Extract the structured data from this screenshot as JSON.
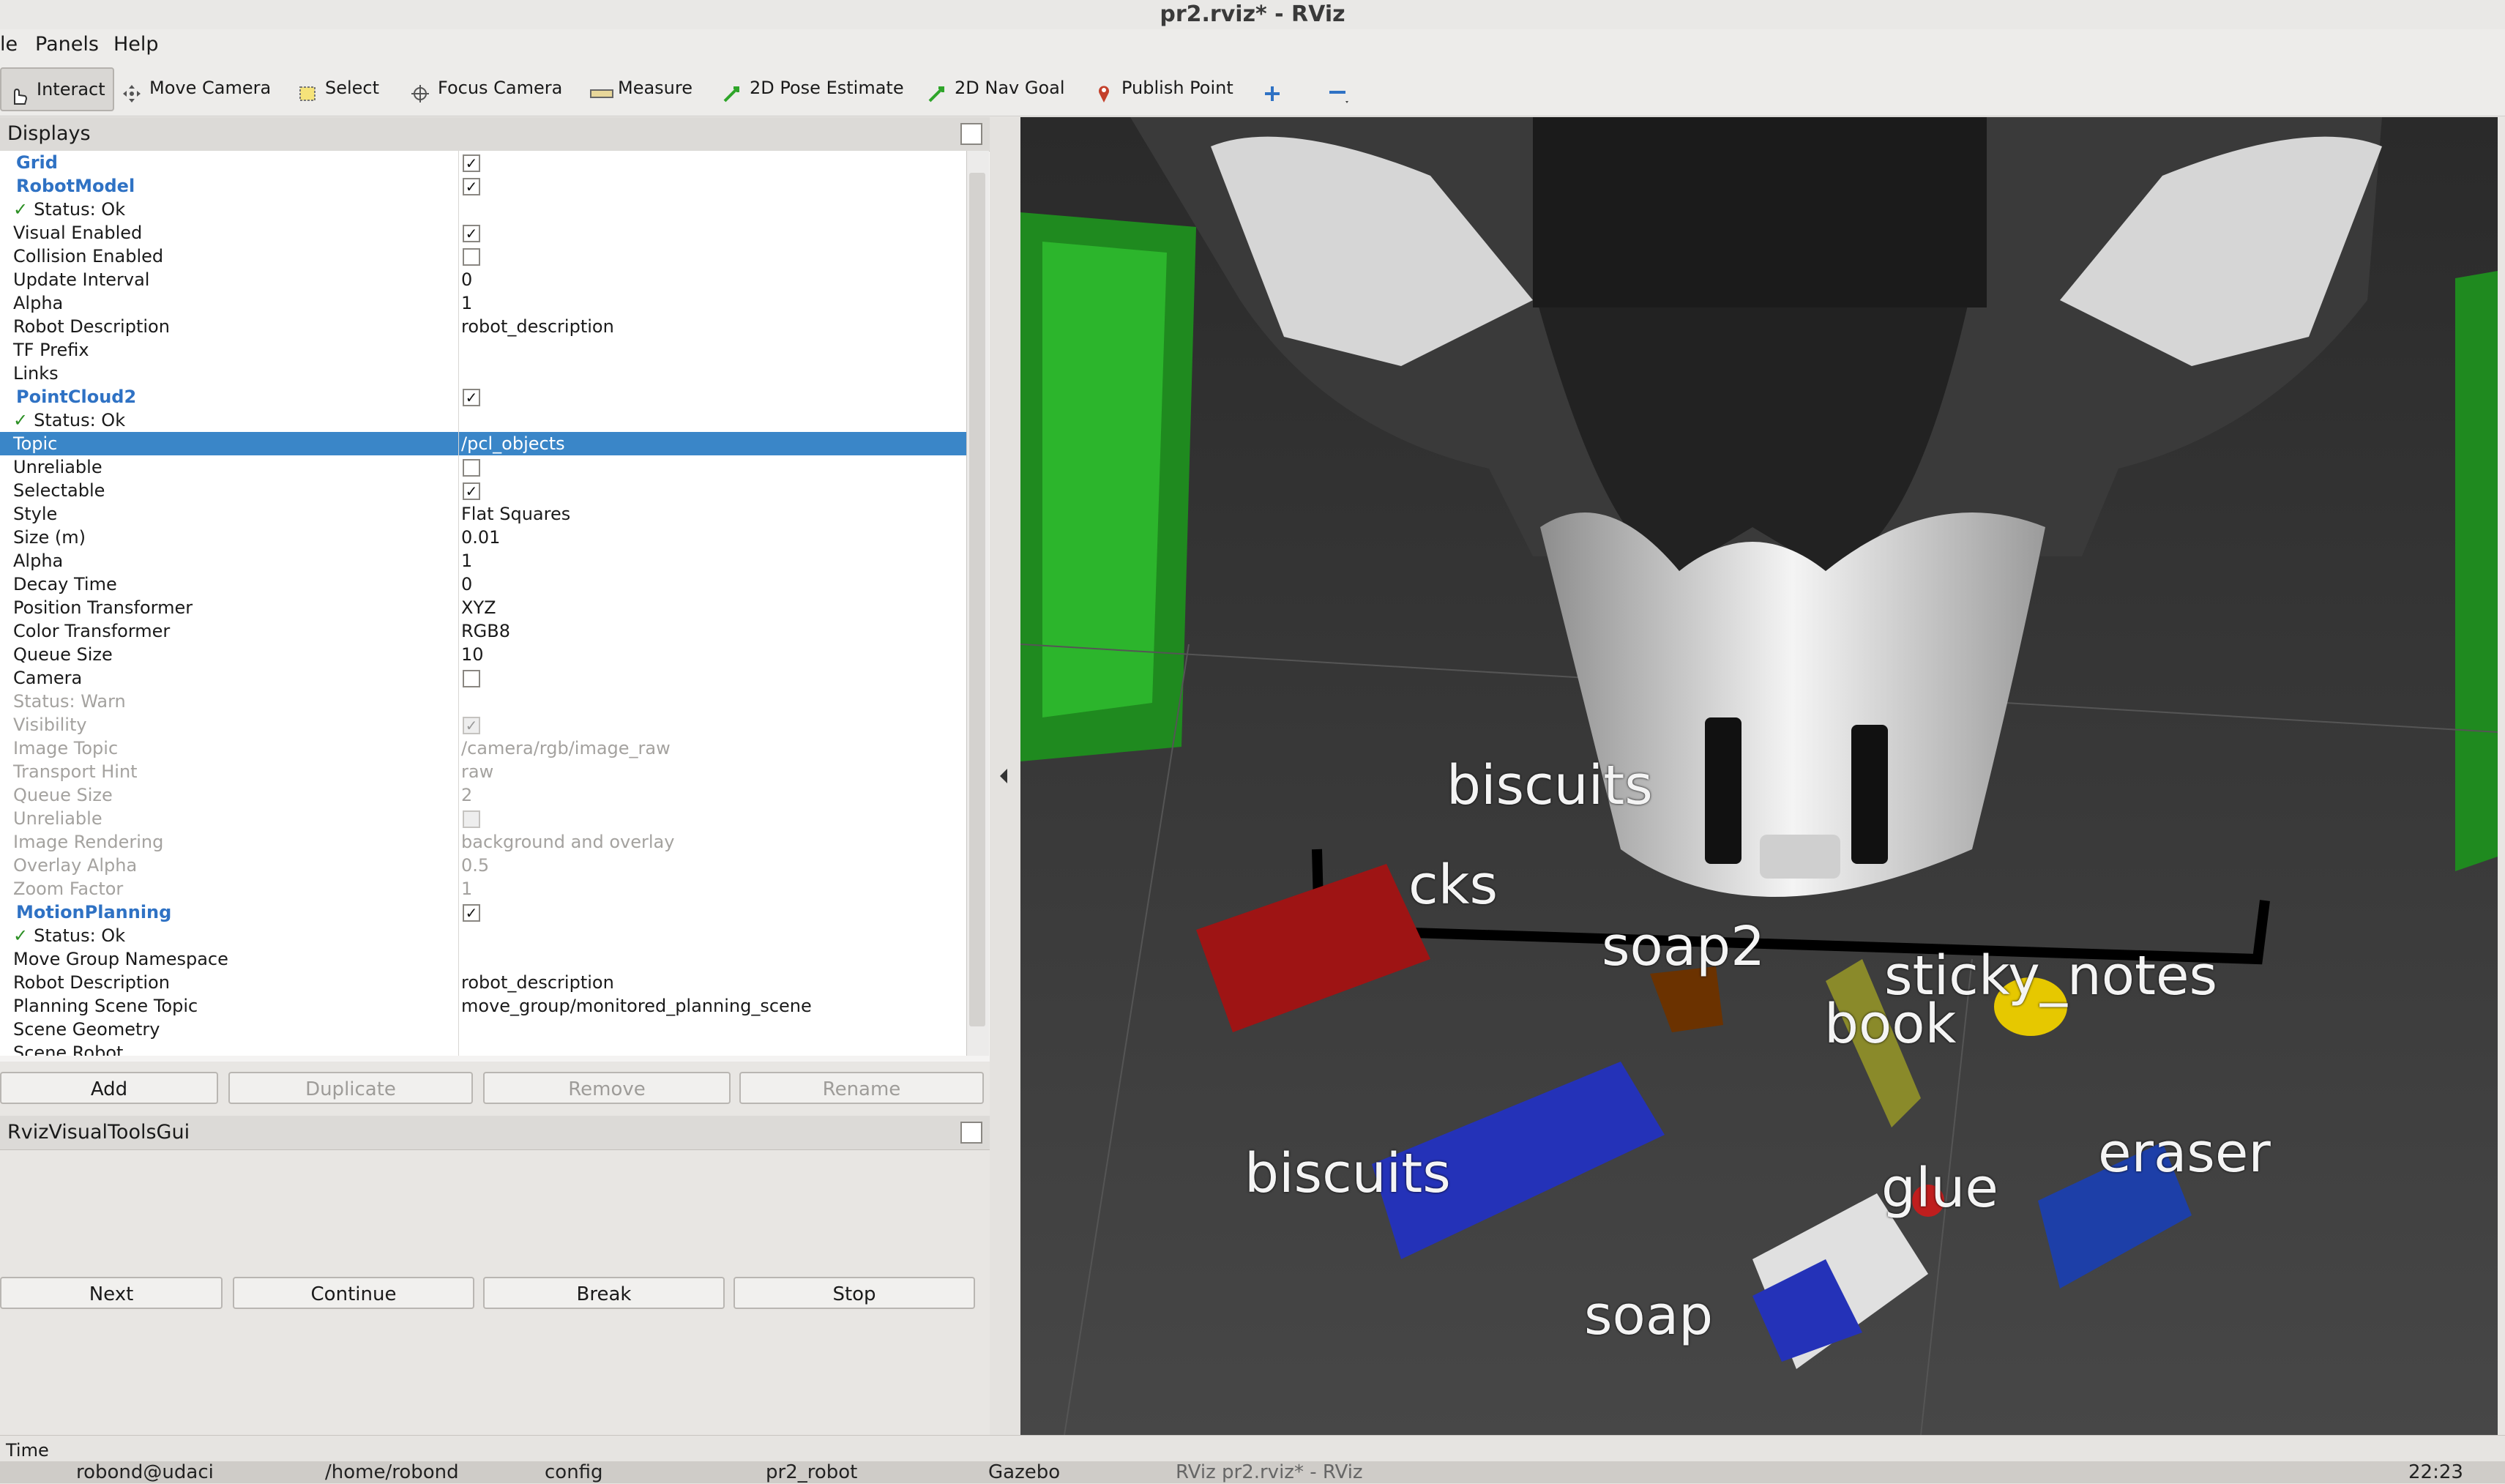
{
  "window": {
    "title": "pr2.rviz* - RViz"
  },
  "menubar": {
    "items": [
      "le",
      "Panels",
      "Help"
    ]
  },
  "toolbar": {
    "tools": [
      {
        "label": "Interact",
        "icon": "hand-pointer-icon",
        "active": true
      },
      {
        "label": "Move Camera",
        "icon": "move-camera-icon"
      },
      {
        "label": "Select",
        "icon": "select-box-icon"
      },
      {
        "label": "Focus Camera",
        "icon": "focus-camera-icon"
      },
      {
        "label": "Measure",
        "icon": "ruler-icon"
      },
      {
        "label": "2D Pose Estimate",
        "icon": "green-arrow-icon"
      },
      {
        "label": "2D Nav Goal",
        "icon": "green-arrow-icon"
      },
      {
        "label": "Publish Point",
        "icon": "map-pin-icon"
      }
    ]
  },
  "displays": {
    "title": "Displays",
    "rows": [
      {
        "name": "Grid",
        "type": "group",
        "checked": true
      },
      {
        "name": "RobotModel",
        "type": "group",
        "checked": true
      },
      {
        "name": "Status: Ok",
        "type": "status"
      },
      {
        "name": "Visual Enabled",
        "checked": true
      },
      {
        "name": "Collision Enabled",
        "checked": false
      },
      {
        "name": "Update Interval",
        "value": "0"
      },
      {
        "name": "Alpha",
        "value": "1"
      },
      {
        "name": "Robot Description",
        "value": "robot_description"
      },
      {
        "name": "TF Prefix",
        "value": ""
      },
      {
        "name": "Links",
        "value": ""
      },
      {
        "name": "PointCloud2",
        "type": "group",
        "checked": true
      },
      {
        "name": "Status: Ok",
        "type": "status"
      },
      {
        "name": "Topic",
        "value": "/pcl_objects",
        "selected": true
      },
      {
        "name": "Unreliable",
        "checked": false
      },
      {
        "name": "Selectable",
        "checked": true
      },
      {
        "name": "Style",
        "value": "Flat Squares"
      },
      {
        "name": "Size (m)",
        "value": "0.01"
      },
      {
        "name": "Alpha",
        "value": "1"
      },
      {
        "name": "Decay Time",
        "value": "0"
      },
      {
        "name": "Position Transformer",
        "value": "XYZ"
      },
      {
        "name": "Color Transformer",
        "value": "RGB8"
      },
      {
        "name": "Queue Size",
        "value": "10"
      },
      {
        "name": "Camera",
        "checked": false
      },
      {
        "name": "Status: Warn",
        "disabled": true
      },
      {
        "name": "Visibility",
        "checked": true,
        "disabled": true
      },
      {
        "name": "Image Topic",
        "value": "/camera/rgb/image_raw",
        "disabled": true
      },
      {
        "name": "Transport Hint",
        "value": "raw",
        "disabled": true
      },
      {
        "name": "Queue Size",
        "value": "2",
        "disabled": true
      },
      {
        "name": "Unreliable",
        "checked": false,
        "disabled": true
      },
      {
        "name": "Image Rendering",
        "value": "background and overlay",
        "disabled": true
      },
      {
        "name": "Overlay Alpha",
        "value": "0.5",
        "disabled": true
      },
      {
        "name": "Zoom Factor",
        "value": "1",
        "disabled": true
      },
      {
        "name": "MotionPlanning",
        "type": "group",
        "checked": true
      },
      {
        "name": "Status: Ok",
        "type": "status"
      },
      {
        "name": "Move Group Namespace",
        "value": ""
      },
      {
        "name": "Robot Description",
        "value": "robot_description"
      },
      {
        "name": "Planning Scene Topic",
        "value": "move_group/monitored_planning_scene"
      },
      {
        "name": "Scene Geometry",
        "value": ""
      },
      {
        "name": "Scene Robot",
        "value": ""
      }
    ],
    "buttons": {
      "add": "Add",
      "duplicate": "Duplicate",
      "remove": "Remove",
      "rename": "Rename"
    }
  },
  "tools_panel": {
    "title": "RvizVisualToolsGui",
    "buttons": {
      "next": "Next",
      "continue": "Continue",
      "break": "Break",
      "stop": "Stop"
    }
  },
  "viewport": {
    "labels": [
      "biscuits",
      "cks",
      "soap2",
      "sticky_notes",
      "book",
      "biscuits",
      "glue",
      "eraser",
      "soap"
    ]
  },
  "statusbar": {
    "label": "Time"
  },
  "taskbar": {
    "items": [
      "robond@udaci",
      "/home/robond",
      "config",
      "pr2_robot",
      "Gazebo",
      "RViz pr2.rviz* - RViz"
    ],
    "clock": "22:23"
  }
}
